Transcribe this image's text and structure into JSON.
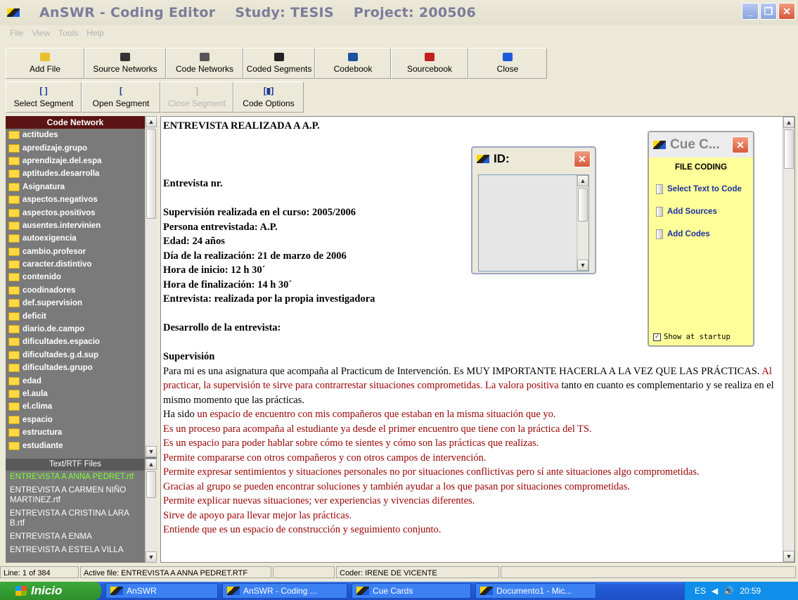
{
  "window": {
    "title_app": "AnSWR - Coding Editor",
    "title_study": "Study: TESIS",
    "title_project": "Project: 200506",
    "buttons": [
      "_",
      "❐",
      "✕"
    ]
  },
  "menu": [
    "File",
    "View",
    "Tools",
    "Help"
  ],
  "toolbar1": [
    {
      "label": "Add File",
      "icon": "add-file-icon",
      "w": 112
    },
    {
      "label": "Source Networks",
      "icon": "source-networks-icon",
      "w": 116
    },
    {
      "label": "Code Networks",
      "icon": "code-networks-icon",
      "w": 110
    },
    {
      "label": "Coded Segments",
      "icon": "coded-segments-icon",
      "w": 102
    },
    {
      "label": "Codebook",
      "icon": "codebook-icon",
      "w": 108
    },
    {
      "label": "Sourcebook",
      "icon": "sourcebook-icon",
      "w": 110
    },
    {
      "label": "Close",
      "icon": "close-icon",
      "w": 112
    }
  ],
  "toolbar2": [
    {
      "label": "Select Segment",
      "icon": "[ ]",
      "w": 108,
      "enabled": true
    },
    {
      "label": "Open Segment",
      "icon": "[",
      "w": 112,
      "enabled": true
    },
    {
      "label": "Close Segment",
      "icon": "]",
      "w": 104,
      "enabled": false
    },
    {
      "label": "Code Options",
      "icon": "[▮]",
      "w": 100,
      "enabled": true
    }
  ],
  "code_network": {
    "header": "Code Network",
    "items": [
      "actitudes",
      "apredizaje.grupo",
      "aprendizaje.del.espa",
      "aptitudes.desarrolla",
      "Asignatura",
      "aspectos.negativos",
      "aspectos.positivos",
      "ausentes.intervinien",
      "autoexigencia",
      "cambio.profesor",
      "caracter.distintivo",
      "contenido",
      "coodinadores",
      "def.supervision",
      "deficit",
      "diario.de.campo",
      "dificultades.espacio",
      "dificultades.g.d.sup",
      "dificultades.grupo",
      "edad",
      "el.aula",
      "el.clima",
      "espacio",
      "estructura",
      "estudiante"
    ]
  },
  "text_files": {
    "header": "Text/RTF Files",
    "items": [
      {
        "name": "ENTREVISTA A ANNA PEDRET.rtf",
        "active": true
      },
      {
        "name": "ENTREVISTA A CARMEN NIÑO MARTINEZ.rtf",
        "active": false
      },
      {
        "name": "ENTREVISTA A CRISTINA LARA B.rtf",
        "active": false
      },
      {
        "name": "ENTREVISTA A ENMA",
        "active": false
      },
      {
        "name": "ENTREVISTA A ESTELA VILLA",
        "active": false
      }
    ]
  },
  "document": {
    "title": "ENTREVISTA REALIZADA A A.P.",
    "entrevista_nr": "Entrevista nr.",
    "meta": [
      "Supervisión realizada en el curso: 2005/2006",
      "Persona entrevistada: A.P.",
      "Edad: 24 años",
      "Día de la realización: 21 de marzo de 2006",
      "Hora de inicio: 12 h 30´",
      "Hora de finalización: 14 h 30´",
      "Entrevista: realizada por la propia investigadora"
    ],
    "desarrollo": "Desarrollo de la entrevista:",
    "supervision_heading": "Supervisión",
    "p1_a": "Para mi es una asignatura que acompaña al Practicum de Intervención. Es MUY IMPORTANTE HACERLA A LA VEZ QUE LAS PRÁCTICAS.",
    "p1_b": "Al  practicar, la supervisión te sirve para contrarrestar situaciones comprometidas. La valora positiva",
    "p1_c": "tanto en cuanto es complementario y se realiza en el mismo momento que las prácticas.",
    "p2_a": "Ha sido ",
    "p2_b": "un espacio de encuentro con mis compañeros que estaban en la misma situación que yo.",
    "red_lines": [
      "Es un proceso para acompaña  al estudiante ya desde el primer encuentro que tiene con la práctica del TS.",
      "Es un espacio para poder hablar sobre cómo te sientes y cómo son las prácticas que realizas.",
      "Permite compararse con otros compañeros y con otros campos de intervención.",
      "Permite expresar sentimientos y situaciones personales no por situaciones conflictivas pero sí ante situaciones algo comprometidas.",
      "Gracias al grupo se pueden encontrar soluciones y también ayudar a los que pasan por situaciones comprometidas.",
      "Permite explicar nuevas situaciones; ver experiencias y vivencias diferentes.",
      "Sirve de apoyo para llevar mejor las prácticas.",
      "Entiende que es un espacio de construcción y seguimiento conjunto."
    ]
  },
  "id_window": {
    "title": "ID:"
  },
  "cue_cards": {
    "title": "Cue C...",
    "heading": "FILE CODING",
    "items": [
      "Select Text to Code",
      "Add Sources",
      "Add Codes"
    ],
    "show_at_startup": "Show at startup"
  },
  "status": {
    "line": "Line: 1 of 384",
    "active_file": "Active file: ENTREVISTA A ANNA PEDRET.RTF",
    "coder": "Coder: IRENE DE VICENTE"
  },
  "taskbar": {
    "start": "Inicio",
    "tasks": [
      {
        "label": "AnSWR",
        "w": 160
      },
      {
        "label": "AnSWR - Coding ...",
        "w": 178
      },
      {
        "label": "Cue Cards",
        "w": 170
      },
      {
        "label": "Documento1 - Mic...",
        "w": 172
      }
    ],
    "lang": "ES",
    "time": "20:59"
  }
}
